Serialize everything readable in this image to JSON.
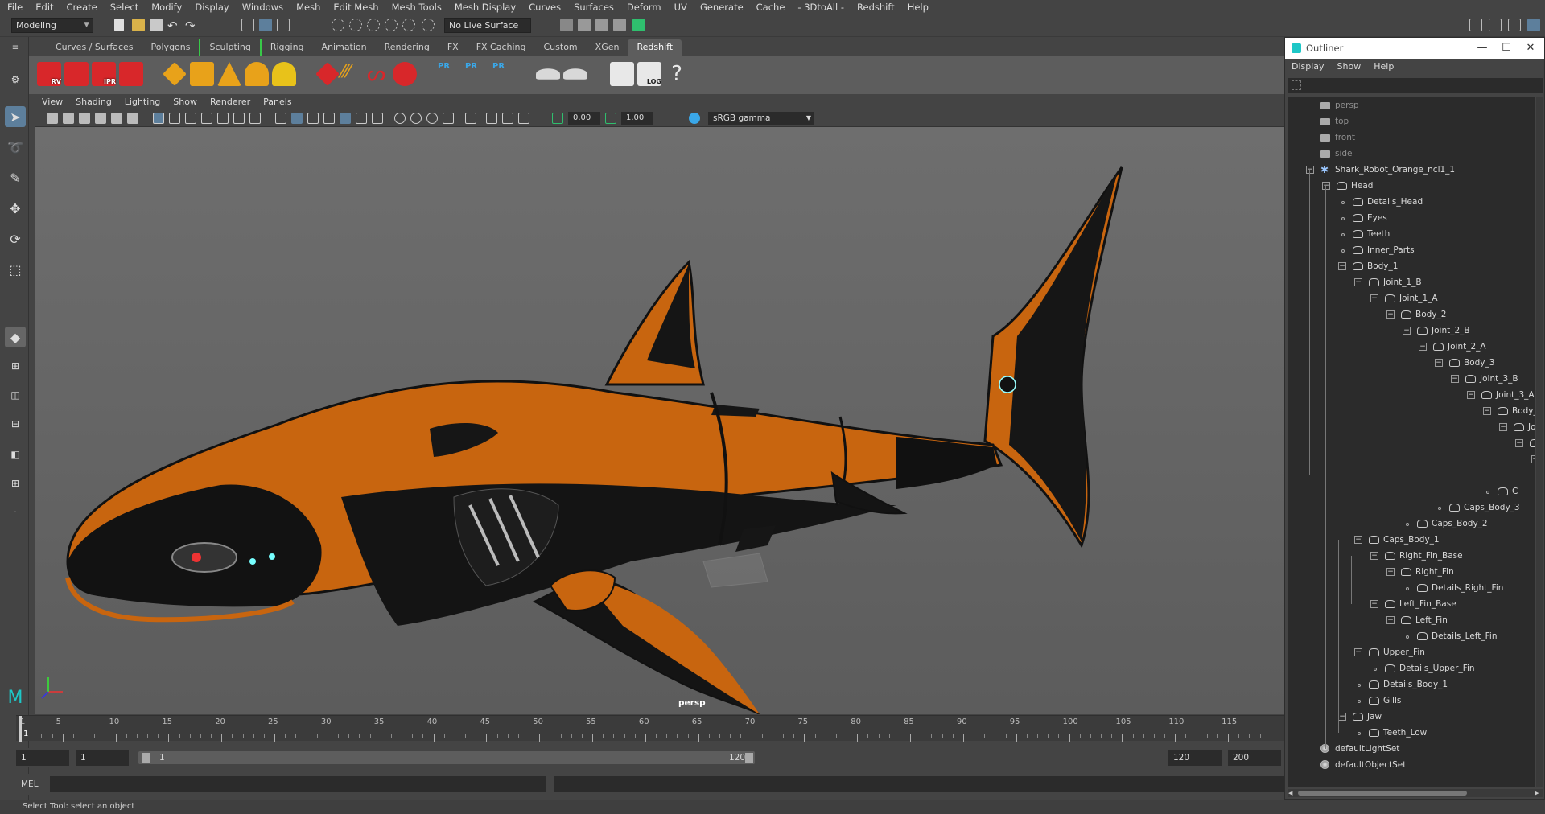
{
  "menubar": [
    "File",
    "Edit",
    "Create",
    "Select",
    "Modify",
    "Display",
    "Windows",
    "Mesh",
    "Edit Mesh",
    "Mesh Tools",
    "Mesh Display",
    "Curves",
    "Surfaces",
    "Deform",
    "UV",
    "Generate",
    "Cache",
    "- 3DtoAll -",
    "Redshift",
    "Help"
  ],
  "statusline": {
    "mode": "Modeling",
    "live_surface": "No Live Surface"
  },
  "shelf_tabs": [
    "Curves / Surfaces",
    "Polygons",
    "Sculpting",
    "Rigging",
    "Animation",
    "Rendering",
    "FX",
    "FX Caching",
    "Custom",
    "XGen",
    "Redshift"
  ],
  "shelf_active": "Redshift",
  "shelf_labels": {
    "rv": "RV",
    "ipr": "IPR",
    "pr": "PR",
    "log": "LOG",
    "help": "?"
  },
  "panel_menu": [
    "View",
    "Shading",
    "Lighting",
    "Show",
    "Renderer",
    "Panels"
  ],
  "panel_toolbar": {
    "exposure": "0.00",
    "gamma": "1.00",
    "color_space": "sRGB gamma"
  },
  "viewport": {
    "camera": "persp"
  },
  "timeline": {
    "ticks": [
      1,
      5,
      10,
      15,
      20,
      25,
      30,
      35,
      40,
      45,
      50,
      55,
      60,
      65,
      70,
      75,
      80,
      85,
      90,
      95,
      100,
      105,
      110,
      115
    ],
    "current": "1"
  },
  "range": {
    "start": "1",
    "playback_start": "1",
    "range_start": "1",
    "range_end": "120",
    "playback_end": "120",
    "end": "200"
  },
  "cmdline": {
    "label": "MEL"
  },
  "helpline": "Select Tool: select an object",
  "outliner": {
    "title": "Outliner",
    "menu": [
      "Display",
      "Show",
      "Help"
    ],
    "items": [
      {
        "label": "persp",
        "depth": 0,
        "type": "camera",
        "dim": true
      },
      {
        "label": "top",
        "depth": 0,
        "type": "camera",
        "dim": true
      },
      {
        "label": "front",
        "depth": 0,
        "type": "camera",
        "dim": true
      },
      {
        "label": "side",
        "depth": 0,
        "type": "camera",
        "dim": true
      },
      {
        "label": "Shark_Robot_Orange_ncl1_1",
        "depth": 0,
        "type": "group",
        "exp": "-"
      },
      {
        "label": "Head",
        "depth": 1,
        "type": "mesh",
        "exp": "-"
      },
      {
        "label": "Details_Head",
        "depth": 2,
        "type": "mesh"
      },
      {
        "label": "Eyes",
        "depth": 2,
        "type": "mesh"
      },
      {
        "label": "Teeth",
        "depth": 2,
        "type": "mesh"
      },
      {
        "label": "Inner_Parts",
        "depth": 2,
        "type": "mesh"
      },
      {
        "label": "Body_1",
        "depth": 2,
        "type": "mesh",
        "exp": "-"
      },
      {
        "label": "Joint_1_B",
        "depth": 3,
        "type": "mesh",
        "exp": "-"
      },
      {
        "label": "Joint_1_A",
        "depth": 4,
        "type": "mesh",
        "exp": "-"
      },
      {
        "label": "Body_2",
        "depth": 5,
        "type": "mesh",
        "exp": "-"
      },
      {
        "label": "Joint_2_B",
        "depth": 6,
        "type": "mesh",
        "exp": "-"
      },
      {
        "label": "Joint_2_A",
        "depth": 7,
        "type": "mesh",
        "exp": "-"
      },
      {
        "label": "Body_3",
        "depth": 8,
        "type": "mesh",
        "exp": "-"
      },
      {
        "label": "Joint_3_B",
        "depth": 9,
        "type": "mesh",
        "exp": "-"
      },
      {
        "label": "Joint_3_A",
        "depth": 10,
        "type": "mesh",
        "exp": "-"
      },
      {
        "label": "Body_",
        "depth": 11,
        "type": "mesh",
        "exp": "-"
      },
      {
        "label": "Jo",
        "depth": 12,
        "type": "mesh",
        "exp": "-"
      },
      {
        "label": "",
        "depth": 13,
        "type": "mesh",
        "exp": "-"
      },
      {
        "label": "",
        "depth": 14,
        "type": "mesh",
        "exp": "-"
      },
      {
        "label": "",
        "depth": 14,
        "type": "none"
      },
      {
        "label": "C",
        "depth": 11,
        "type": "mesh"
      },
      {
        "label": "Caps_Body_3",
        "depth": 8,
        "type": "mesh"
      },
      {
        "label": "Caps_Body_2",
        "depth": 6,
        "type": "mesh"
      },
      {
        "label": "Caps_Body_1",
        "depth": 3,
        "type": "mesh",
        "exp": "-"
      },
      {
        "label": "Right_Fin_Base",
        "depth": 4,
        "type": "mesh",
        "exp": "-"
      },
      {
        "label": "Right_Fin",
        "depth": 5,
        "type": "mesh",
        "exp": "-"
      },
      {
        "label": "Details_Right_Fin",
        "depth": 6,
        "type": "mesh"
      },
      {
        "label": "Left_Fin_Base",
        "depth": 4,
        "type": "mesh",
        "exp": "-"
      },
      {
        "label": "Left_Fin",
        "depth": 5,
        "type": "mesh",
        "exp": "-"
      },
      {
        "label": "Details_Left_Fin",
        "depth": 6,
        "type": "mesh"
      },
      {
        "label": "Upper_Fin",
        "depth": 3,
        "type": "mesh",
        "exp": "-"
      },
      {
        "label": "Details_Upper_Fin",
        "depth": 4,
        "type": "mesh"
      },
      {
        "label": "Details_Body_1",
        "depth": 3,
        "type": "mesh"
      },
      {
        "label": "Gills",
        "depth": 3,
        "type": "mesh"
      },
      {
        "label": "Jaw",
        "depth": 2,
        "type": "mesh",
        "exp": "-"
      },
      {
        "label": "Teeth_Low",
        "depth": 3,
        "type": "mesh"
      },
      {
        "label": "defaultLightSet",
        "depth": 0,
        "type": "set"
      },
      {
        "label": "defaultObjectSet",
        "depth": 0,
        "type": "set"
      }
    ]
  },
  "colors": {
    "accent_blue": "#5d7f9c",
    "shark_orange": "#c8650f",
    "redshift_red": "#d8272a",
    "mode_green": "#38c948"
  }
}
